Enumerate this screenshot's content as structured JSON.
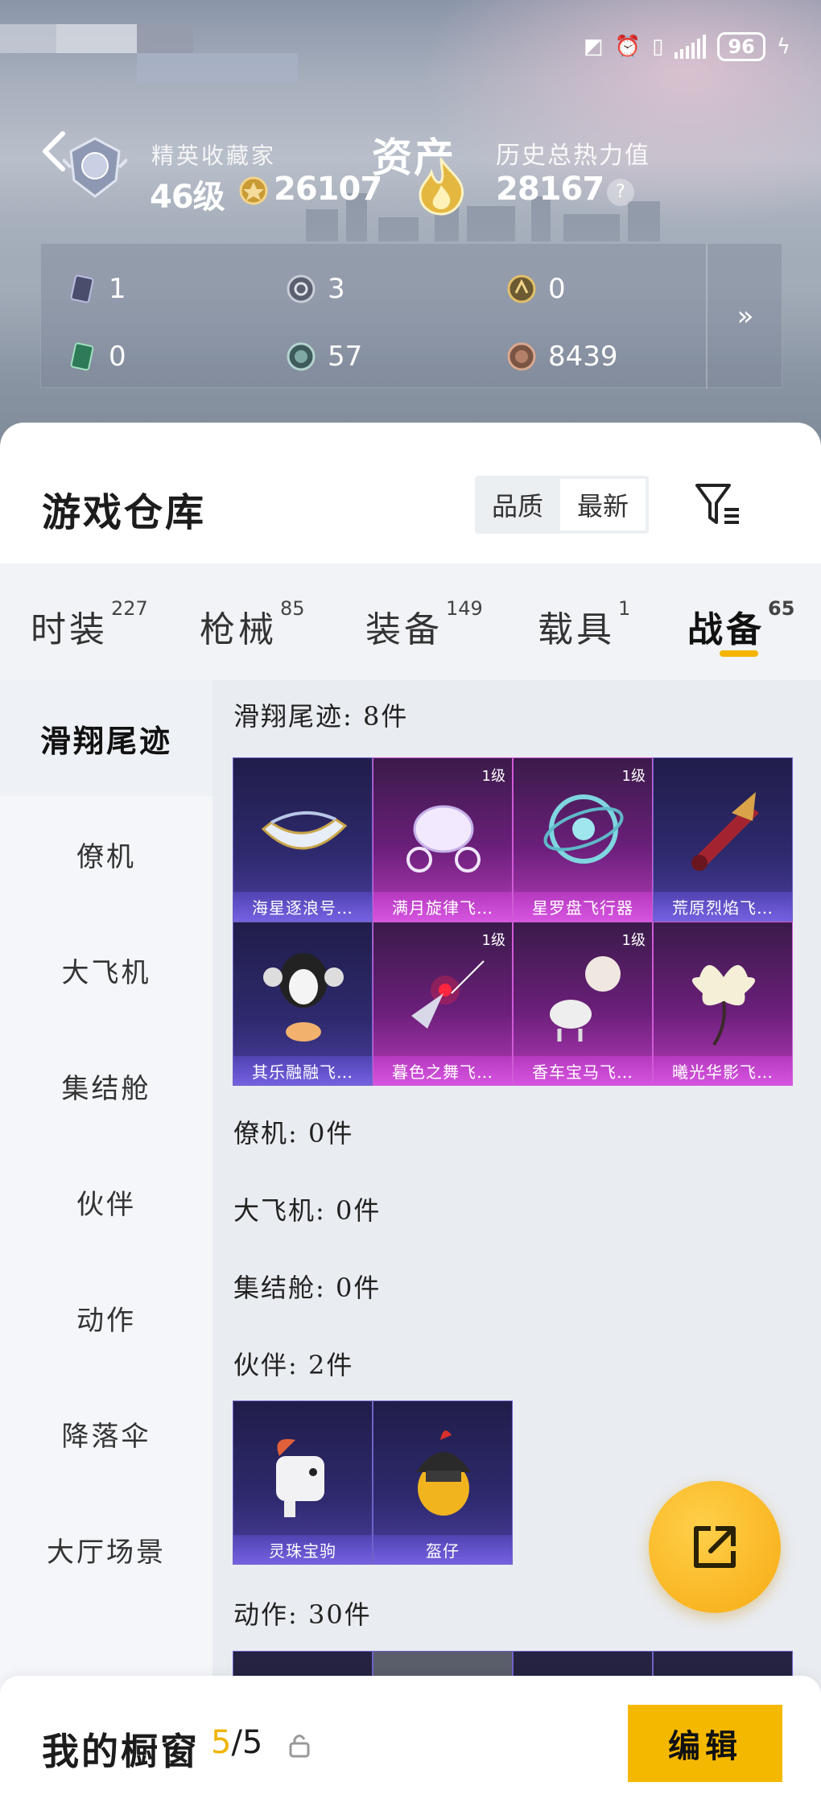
{
  "status_bar": {
    "battery": "96"
  },
  "profile": {
    "title": "精英收藏家",
    "level": "46级",
    "coins": "26107",
    "asset_title": "资产",
    "history_label": "历史总热力值",
    "history_value": "28167",
    "help": "?"
  },
  "currencies": [
    {
      "icon": "card-icon",
      "value": "1"
    },
    {
      "icon": "silver-coin-icon",
      "value": "3"
    },
    {
      "icon": "gold-coin-icon",
      "value": "0"
    },
    {
      "icon": "green-ticket-icon",
      "value": "0"
    },
    {
      "icon": "teal-coin-icon",
      "value": "57"
    },
    {
      "icon": "bronze-coin-icon",
      "value": "8439"
    }
  ],
  "warehouse": {
    "title": "游戏仓库",
    "sort_options": [
      "品质",
      "最新"
    ],
    "active_sort": "最新"
  },
  "tabs": [
    {
      "label": "时装",
      "count": "227"
    },
    {
      "label": "枪械",
      "count": "85"
    },
    {
      "label": "装备",
      "count": "149"
    },
    {
      "label": "载具",
      "count": "1"
    },
    {
      "label": "战备",
      "count": "65"
    }
  ],
  "active_tab": "战备",
  "sidebar": [
    "滑翔尾迹",
    "僚机",
    "大飞机",
    "集结舱",
    "伙伴",
    "动作",
    "降落伞",
    "大厅场景"
  ],
  "sections": {
    "glide": {
      "label": "滑翔尾迹: 8件",
      "items": [
        {
          "name": "海星逐浪号…",
          "level": "",
          "rarity": "purple"
        },
        {
          "name": "满月旋律飞…",
          "level": "1级",
          "rarity": "pink"
        },
        {
          "name": "星罗盘飞行器",
          "level": "1级",
          "rarity": "pink"
        },
        {
          "name": "荒原烈焰飞…",
          "level": "",
          "rarity": "purple"
        },
        {
          "name": "其乐融融飞…",
          "level": "",
          "rarity": "purple"
        },
        {
          "name": "暮色之舞飞…",
          "level": "1级",
          "rarity": "pink"
        },
        {
          "name": "香车宝马飞…",
          "level": "1级",
          "rarity": "pink"
        },
        {
          "name": "曦光华影飞…",
          "level": "",
          "rarity": "pink"
        }
      ]
    },
    "wingman": {
      "label": "僚机: 0件"
    },
    "plane": {
      "label": "大飞机: 0件"
    },
    "pod": {
      "label": "集结舱: 0件"
    },
    "partner": {
      "label": "伙伴: 2件",
      "items": [
        {
          "name": "灵珠宝驹",
          "level": "",
          "rarity": "purple"
        },
        {
          "name": "盔仔",
          "level": "",
          "rarity": "purple"
        }
      ]
    },
    "emote": {
      "label": "动作: 30件"
    }
  },
  "showcase": {
    "title": "我的橱窗",
    "current": "5",
    "total": "/5",
    "edit_label": "编辑"
  },
  "colors": {
    "accent": "#f5b800",
    "purple_card": "#2e2a6e",
    "pink_card": "#6b1f7a"
  }
}
